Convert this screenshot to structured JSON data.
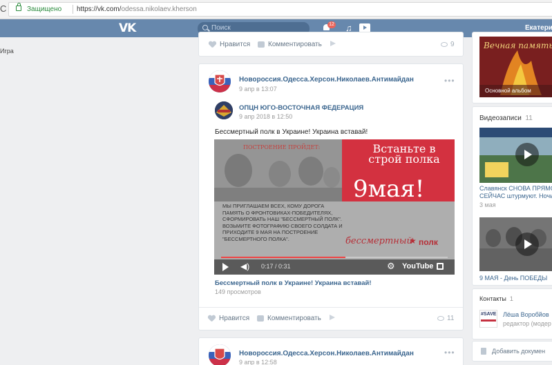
{
  "browser": {
    "reload_icon": "reload-icon",
    "secure_label": "Защищено",
    "url_host": "https://vk.com/",
    "url_path": "odessa.nikolaev.kherson"
  },
  "header": {
    "logo": "VK",
    "search_placeholder": "Поиск",
    "notif_badge": "12",
    "user_name": "Екатерина"
  },
  "left_sidebar": {
    "fragment": "Игра"
  },
  "post_prev": {
    "like_label": "Нравится",
    "comment_label": "Комментировать",
    "views": "9"
  },
  "post": {
    "group_name": "Новороссия.Одесса.Херсон.Николаев.Антимайдан",
    "date": "9 апр в 13:07",
    "repost_name": "ОПЦН ЮГО-ВОСТОЧНАЯ ФЕДЕРАЦИЯ",
    "repost_date": "9 апр 2018 в 12:50",
    "text": "Бессмертный полк в Украине! Украина вставай!",
    "video": {
      "poster_heading": "ПОСТРОЕНИЕ ПРОЙДЕТ:",
      "poster_red_top": "Встаньте в строй полка",
      "poster_red_big": "9мая!",
      "poster_body": "МЫ ПРИГЛАШАЕМ ВСЕХ, КОМУ ДОРОГА ПАМЯТЬ О ФРОНТОВИКАХ-ПОБЕДИТЕЛЯХ, СФОРМИРОВАТЬ НАШ \"БЕССМЕРТНЫЙ ПОЛК\". ВОЗЬМИТЕ ФОТОГРАФИЮ СВОЕГО СОЛДАТА И ПРИХОДИТЕ 9 МАЯ НА ПОСТРОЕНИЕ \"БЕССМЕРТНОГО ПОЛКА\".",
      "logo_script": "бессмертный",
      "logo_word": "полк",
      "time": "0:17 / 0:31",
      "youtube": "YouTube",
      "progress": 0.55
    },
    "video_title": "Бессмертный полк в Украине! Украина вставай!",
    "video_views": "149 просмотров",
    "like_label": "Нравится",
    "comment_label": "Комментировать",
    "views": "11"
  },
  "post_next": {
    "group_name": "Новороссия.Одесса.Херсон.Николаев.Антимайдан",
    "date": "9 апр в 12:58"
  },
  "right": {
    "album_title": "Вечная память",
    "album_caption": "Основной альбом",
    "videos_label": "Видеозаписи",
    "videos_count": "11",
    "video1_title_1": "Славянск СНОВА ПРЯМО",
    "video1_title_2": "СЕЙЧАС штурмуют. Ночь",
    "video1_date": "3 мая",
    "video2_title": "9 МАЯ - День ПОБЕДЫ",
    "contacts_label": "Контакты",
    "contacts_count": "1",
    "contact_name": "Лёша Воробйов",
    "contact_role": "редактор (модер",
    "contact_avatar_text": "#SAVE",
    "add_doc": "Добавить докумен"
  }
}
